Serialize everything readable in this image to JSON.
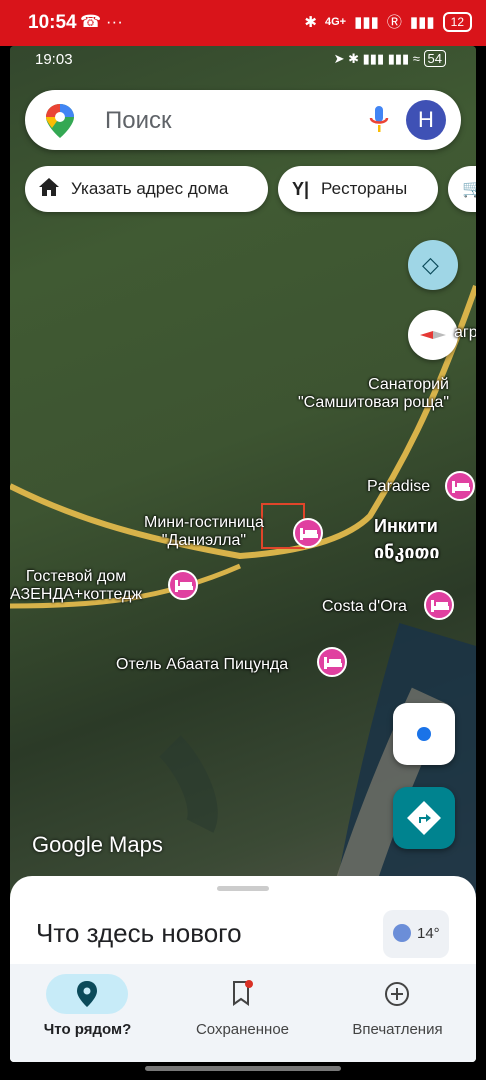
{
  "outer_status": {
    "time": "10:54",
    "network": "4G+",
    "battery": "12"
  },
  "inner_status": {
    "time": "19:03",
    "battery": "54"
  },
  "search": {
    "placeholder": "Поиск",
    "avatar_letter": "Н"
  },
  "chips": [
    {
      "label": "Указать адрес дома",
      "icon": "home-icon"
    },
    {
      "label": "Рестораны",
      "icon": "restaurant-icon"
    }
  ],
  "map_labels": {
    "sanatorium": "Санаторий\n\"Самшитовая роща\"",
    "paradise": "Paradise",
    "inkiti": "Инкити",
    "inkiti_ge": "ინკითი",
    "mini_hotel": "Мини-гостиница\n\"Даниэлла\"",
    "guest_house": "Гостевой дом\nАЗЕНДА+коттедж",
    "costa": "Costa d'Ora",
    "abaata": "Отель Абаата Пицунда",
    "partial": "агр",
    "google": "Google Maps"
  },
  "sheet": {
    "title": "Что здесь нового",
    "temperature": "14°"
  },
  "bottom_nav": [
    {
      "label": "Что рядом?",
      "icon": "location-pin-icon",
      "active": true
    },
    {
      "label": "Сохраненное",
      "icon": "bookmark-icon",
      "active": false
    },
    {
      "label": "Впечатления",
      "icon": "add-circle-icon",
      "active": false
    }
  ],
  "colors": {
    "accent_red": "#d9141a",
    "hotel_pin": "#e040a0",
    "directions": "#00838f",
    "nav_active": "#c7ebf8"
  }
}
